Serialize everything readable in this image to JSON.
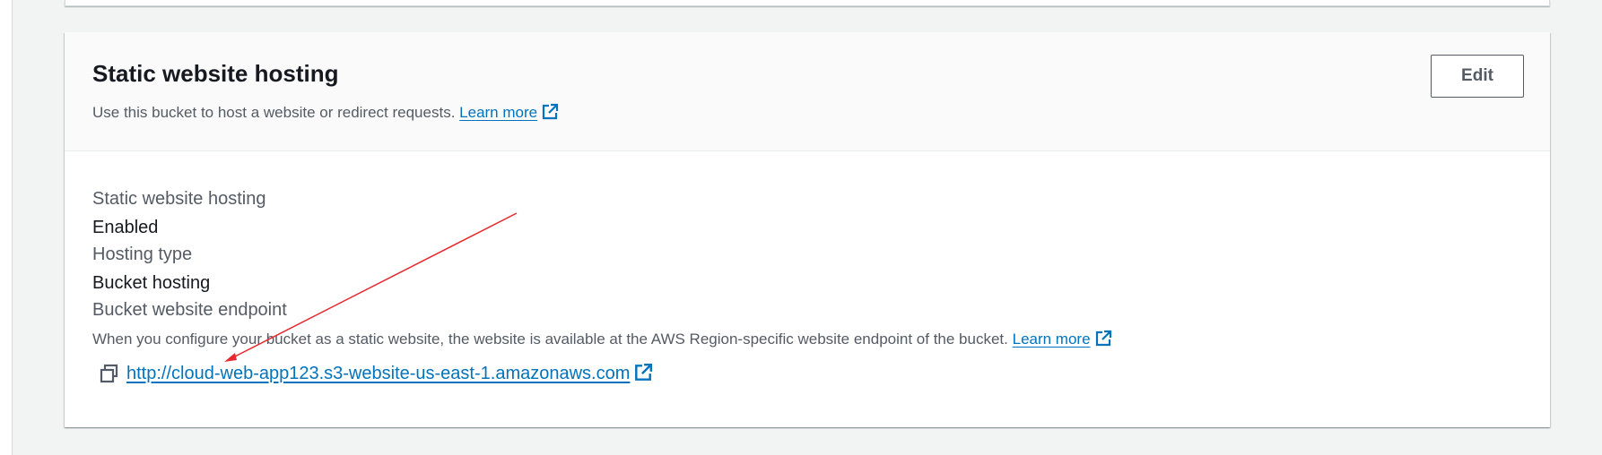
{
  "card": {
    "title": "Static website hosting",
    "description": "Use this bucket to host a website or redirect requests.",
    "learn_more": "Learn more",
    "edit_label": "Edit"
  },
  "fields": {
    "hosting_label": "Static website hosting",
    "hosting_value": "Enabled",
    "type_label": "Hosting type",
    "type_value": "Bucket hosting",
    "endpoint_label": "Bucket website endpoint",
    "endpoint_description": "When you configure your bucket as a static website, the website is available at the AWS Region-specific website endpoint of the bucket.",
    "endpoint_learn_more": "Learn more",
    "endpoint_url": "http://cloud-web-app123.s3-website-us-east-1.amazonaws.com"
  },
  "icons": {
    "external": "external-link-icon",
    "copy": "copy-icon"
  },
  "colors": {
    "link": "#0073bb",
    "annotation_arrow": "#e8272f"
  }
}
